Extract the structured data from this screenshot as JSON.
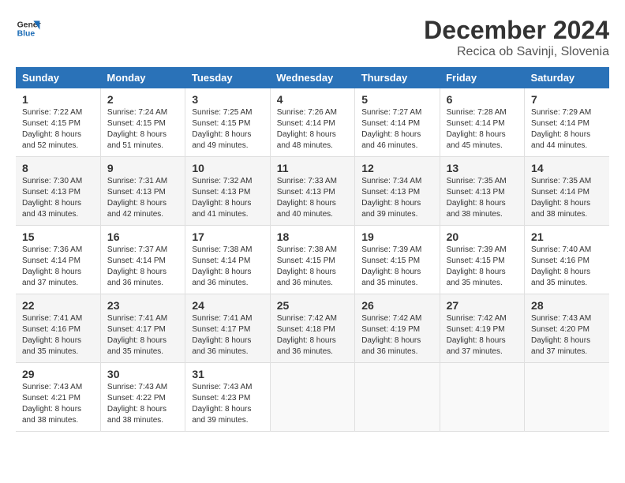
{
  "logo": {
    "line1": "General",
    "line2": "Blue"
  },
  "title": "December 2024",
  "location": "Recica ob Savinji, Slovenia",
  "days_of_week": [
    "Sunday",
    "Monday",
    "Tuesday",
    "Wednesday",
    "Thursday",
    "Friday",
    "Saturday"
  ],
  "weeks": [
    [
      {
        "day": "1",
        "sunrise": "7:22 AM",
        "sunset": "4:15 PM",
        "daylight": "8 hours and 52 minutes."
      },
      {
        "day": "2",
        "sunrise": "7:24 AM",
        "sunset": "4:15 PM",
        "daylight": "8 hours and 51 minutes."
      },
      {
        "day": "3",
        "sunrise": "7:25 AM",
        "sunset": "4:15 PM",
        "daylight": "8 hours and 49 minutes."
      },
      {
        "day": "4",
        "sunrise": "7:26 AM",
        "sunset": "4:14 PM",
        "daylight": "8 hours and 48 minutes."
      },
      {
        "day": "5",
        "sunrise": "7:27 AM",
        "sunset": "4:14 PM",
        "daylight": "8 hours and 46 minutes."
      },
      {
        "day": "6",
        "sunrise": "7:28 AM",
        "sunset": "4:14 PM",
        "daylight": "8 hours and 45 minutes."
      },
      {
        "day": "7",
        "sunrise": "7:29 AM",
        "sunset": "4:14 PM",
        "daylight": "8 hours and 44 minutes."
      }
    ],
    [
      {
        "day": "8",
        "sunrise": "7:30 AM",
        "sunset": "4:13 PM",
        "daylight": "8 hours and 43 minutes."
      },
      {
        "day": "9",
        "sunrise": "7:31 AM",
        "sunset": "4:13 PM",
        "daylight": "8 hours and 42 minutes."
      },
      {
        "day": "10",
        "sunrise": "7:32 AM",
        "sunset": "4:13 PM",
        "daylight": "8 hours and 41 minutes."
      },
      {
        "day": "11",
        "sunrise": "7:33 AM",
        "sunset": "4:13 PM",
        "daylight": "8 hours and 40 minutes."
      },
      {
        "day": "12",
        "sunrise": "7:34 AM",
        "sunset": "4:13 PM",
        "daylight": "8 hours and 39 minutes."
      },
      {
        "day": "13",
        "sunrise": "7:35 AM",
        "sunset": "4:13 PM",
        "daylight": "8 hours and 38 minutes."
      },
      {
        "day": "14",
        "sunrise": "7:35 AM",
        "sunset": "4:14 PM",
        "daylight": "8 hours and 38 minutes."
      }
    ],
    [
      {
        "day": "15",
        "sunrise": "7:36 AM",
        "sunset": "4:14 PM",
        "daylight": "8 hours and 37 minutes."
      },
      {
        "day": "16",
        "sunrise": "7:37 AM",
        "sunset": "4:14 PM",
        "daylight": "8 hours and 36 minutes."
      },
      {
        "day": "17",
        "sunrise": "7:38 AM",
        "sunset": "4:14 PM",
        "daylight": "8 hours and 36 minutes."
      },
      {
        "day": "18",
        "sunrise": "7:38 AM",
        "sunset": "4:15 PM",
        "daylight": "8 hours and 36 minutes."
      },
      {
        "day": "19",
        "sunrise": "7:39 AM",
        "sunset": "4:15 PM",
        "daylight": "8 hours and 35 minutes."
      },
      {
        "day": "20",
        "sunrise": "7:39 AM",
        "sunset": "4:15 PM",
        "daylight": "8 hours and 35 minutes."
      },
      {
        "day": "21",
        "sunrise": "7:40 AM",
        "sunset": "4:16 PM",
        "daylight": "8 hours and 35 minutes."
      }
    ],
    [
      {
        "day": "22",
        "sunrise": "7:41 AM",
        "sunset": "4:16 PM",
        "daylight": "8 hours and 35 minutes."
      },
      {
        "day": "23",
        "sunrise": "7:41 AM",
        "sunset": "4:17 PM",
        "daylight": "8 hours and 35 minutes."
      },
      {
        "day": "24",
        "sunrise": "7:41 AM",
        "sunset": "4:17 PM",
        "daylight": "8 hours and 36 minutes."
      },
      {
        "day": "25",
        "sunrise": "7:42 AM",
        "sunset": "4:18 PM",
        "daylight": "8 hours and 36 minutes."
      },
      {
        "day": "26",
        "sunrise": "7:42 AM",
        "sunset": "4:19 PM",
        "daylight": "8 hours and 36 minutes."
      },
      {
        "day": "27",
        "sunrise": "7:42 AM",
        "sunset": "4:19 PM",
        "daylight": "8 hours and 37 minutes."
      },
      {
        "day": "28",
        "sunrise": "7:43 AM",
        "sunset": "4:20 PM",
        "daylight": "8 hours and 37 minutes."
      }
    ],
    [
      {
        "day": "29",
        "sunrise": "7:43 AM",
        "sunset": "4:21 PM",
        "daylight": "8 hours and 38 minutes."
      },
      {
        "day": "30",
        "sunrise": "7:43 AM",
        "sunset": "4:22 PM",
        "daylight": "8 hours and 38 minutes."
      },
      {
        "day": "31",
        "sunrise": "7:43 AM",
        "sunset": "4:23 PM",
        "daylight": "8 hours and 39 minutes."
      },
      null,
      null,
      null,
      null
    ]
  ]
}
